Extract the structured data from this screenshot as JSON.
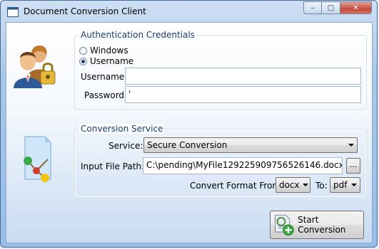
{
  "window": {
    "title": "Document Conversion Client",
    "minimize_glyph": "–",
    "maximize_glyph": "□",
    "close_glyph": "✕"
  },
  "auth": {
    "legend": "Authentication Credentials",
    "radio_windows": "Windows",
    "radio_username": "Username",
    "selected": "Username",
    "username_label": "Username:",
    "username_value": "",
    "password_label": "Password:",
    "password_value": "'",
    "icon": "users-lock-icon"
  },
  "conversion": {
    "legend": "Conversion Service",
    "service_label": "Service:",
    "service_value": "Secure Conversion",
    "input_path_label": "Input File Path:",
    "input_path_value": "C:\\pending\\MyFile129225909756526146.docx",
    "browse_label": "...",
    "convert_from_label": "Convert Format From:",
    "convert_from_value": "docx",
    "to_label": "To:",
    "to_value": "pdf",
    "icon": "document-workflow-icon"
  },
  "actions": {
    "start_label": "Start Conversion",
    "start_icon": "document-add-icon"
  },
  "colors": {
    "accent": "#1e3d6b",
    "close_button": "#c4493a"
  }
}
